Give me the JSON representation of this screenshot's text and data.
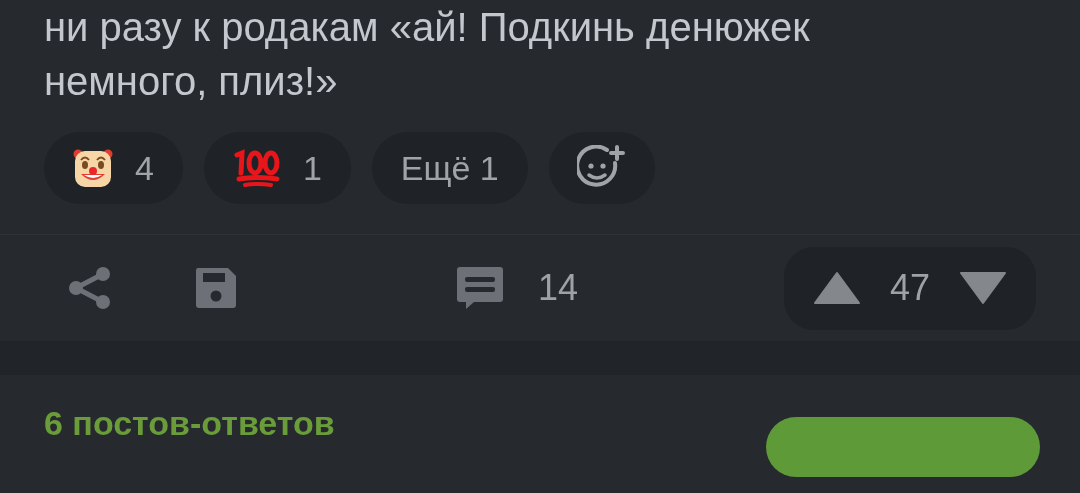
{
  "post": {
    "text": "ни разу к родакам «ай! Подкинь денюжек немного, плиз!»",
    "reactions": [
      {
        "kind": "clown",
        "count": "4"
      },
      {
        "kind": "hundred",
        "count": "1"
      },
      {
        "kind": "more",
        "label": "Ещё 1"
      },
      {
        "kind": "add"
      }
    ],
    "actions": {
      "comments": "14",
      "score": "47"
    }
  },
  "replies": {
    "title": "6 постов-ответов"
  }
}
